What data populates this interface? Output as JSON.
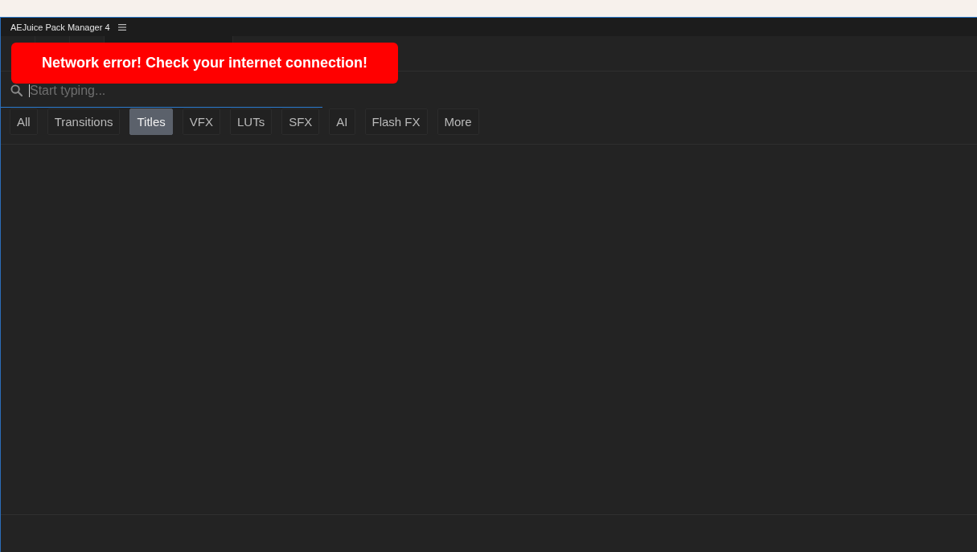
{
  "window": {
    "title": "AEJuice Pack Manager 4"
  },
  "toast": {
    "kind": "error",
    "message": "Network error! Check your internet connection!"
  },
  "search": {
    "placeholder": "Start typing...",
    "focused": true
  },
  "categories": [
    {
      "label": "All",
      "selected": false
    },
    {
      "label": "Transitions",
      "selected": false
    },
    {
      "label": "Titles",
      "selected": true
    },
    {
      "label": "VFX",
      "selected": false
    },
    {
      "label": "LUTs",
      "selected": false
    },
    {
      "label": "SFX",
      "selected": false
    },
    {
      "label": "AI",
      "selected": false
    },
    {
      "label": "Flash FX",
      "selected": false
    },
    {
      "label": "More",
      "selected": false
    }
  ]
}
